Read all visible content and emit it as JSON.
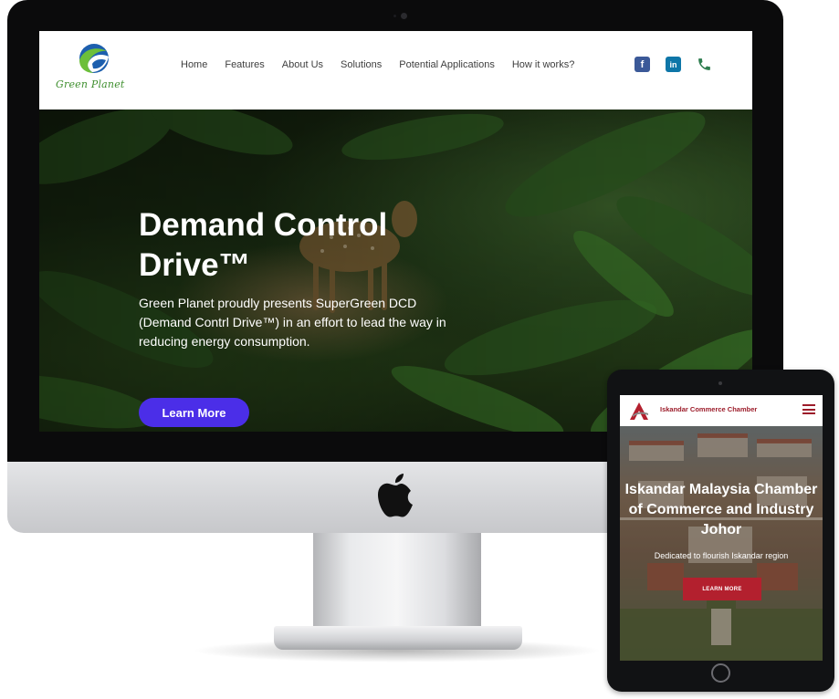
{
  "desktop_site": {
    "logo": {
      "text": "Green Planet"
    },
    "nav": {
      "items": [
        "Home",
        "Features",
        "About Us",
        "Solutions",
        "Potential Applications",
        "How it works?"
      ]
    },
    "social": {
      "facebook_icon": "facebook-icon",
      "linkedin_icon": "linkedin-icon",
      "linkedin_glyph": "in",
      "facebook_glyph": "f",
      "phone_icon": "phone-icon"
    },
    "hero": {
      "title": "Demand Control Drive™",
      "description": "Green Planet proudly presents SuperGreen DCD (Demand Contrl Drive™) in an effort to lead the way in reducing energy consumption.",
      "button_label": "Learn More"
    },
    "colors": {
      "accent": "#4b2ee8",
      "brand_green": "#3f8f2f",
      "brand_blue": "#1d5fae"
    }
  },
  "tablet_site": {
    "brand": "Iskandar Commerce Chamber",
    "hero": {
      "title": "Iskandar Malaysia Chamber of Commerce and Industry Johor",
      "subtitle": "Dedicated to flourish Iskandar region",
      "button_label": "LEARN MORE"
    },
    "colors": {
      "accent": "#b3202e"
    }
  }
}
